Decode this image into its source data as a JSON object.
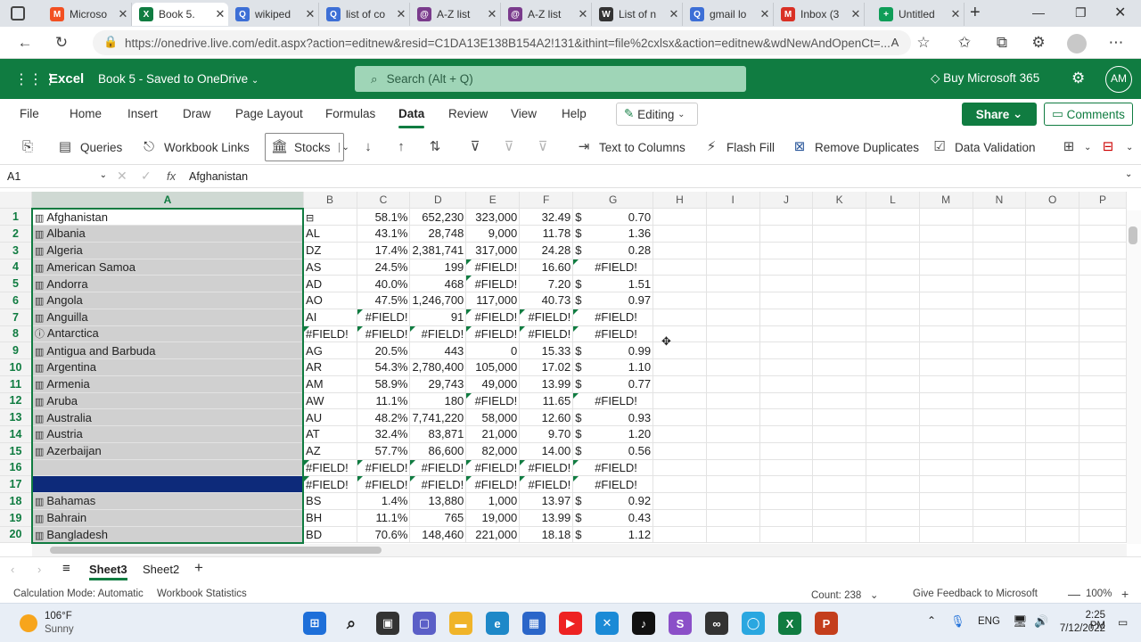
{
  "browser": {
    "tabs": [
      {
        "title": "Microso",
        "fav": "M",
        "color": "#f25022"
      },
      {
        "title": "Book 5.",
        "fav": "X",
        "color": "#107c41",
        "active": true
      },
      {
        "title": "wikiped",
        "fav": "Q",
        "color": "#3d6fd6"
      },
      {
        "title": "list of co",
        "fav": "Q",
        "color": "#3d6fd6"
      },
      {
        "title": "A-Z list",
        "fav": "@",
        "color": "#7a3b8c"
      },
      {
        "title": "A-Z list",
        "fav": "@",
        "color": "#7a3b8c"
      },
      {
        "title": "List of n",
        "fav": "W",
        "color": "#333333"
      },
      {
        "title": "gmail lo",
        "fav": "Q",
        "color": "#3d6fd6"
      },
      {
        "title": "Inbox (3",
        "fav": "M",
        "color": "#d93025"
      },
      {
        "title": "Untitled",
        "fav": "+",
        "color": "#0f9d58"
      }
    ],
    "url": "https://onedrive.live.com/edit.aspx?action=editnew&resid=C1DA13E138B154A2!131&ithint=file%2cxlsx&action=editnew&wdNewAndOpenCt=..."
  },
  "excel": {
    "app": "Excel",
    "doc_title": "Book 5 - Saved to OneDrive",
    "search_placeholder": "Search (Alt + Q)",
    "buy": "Buy Microsoft 365",
    "avatar": "AM",
    "ribbon_tabs": [
      "File",
      "Home",
      "Insert",
      "Draw",
      "Page Layout",
      "Formulas",
      "Data",
      "Review",
      "View",
      "Help"
    ],
    "editing": "Editing",
    "share": "Share",
    "comments": "Comments",
    "ribbon": {
      "queries": "Queries",
      "workbook_links": "Workbook Links",
      "stocks": "Stocks",
      "text_to_columns": "Text to Columns",
      "flash_fill": "Flash Fill",
      "remove_duplicates": "Remove Duplicates",
      "data_validation": "Data Validation"
    },
    "name_box": "A1",
    "formula": "Afghanistan",
    "columns": [
      "A",
      "B",
      "C",
      "D",
      "E",
      "F",
      "G",
      "H",
      "I",
      "J",
      "K",
      "L",
      "M",
      "N",
      "O",
      "P"
    ],
    "rows": [
      {
        "n": "1",
        "a": "Afghanistan",
        "b": "",
        "c": "58.1%",
        "d": "652,230",
        "e": "323,000",
        "f": "32.49",
        "g": "0.70"
      },
      {
        "n": "2",
        "a": "Albania",
        "b": "AL",
        "c": "43.1%",
        "d": "28,748",
        "e": "9,000",
        "f": "11.78",
        "g": "1.36"
      },
      {
        "n": "3",
        "a": "Algeria",
        "b": "DZ",
        "c": "17.4%",
        "d": "2,381,741",
        "e": "317,000",
        "f": "24.28",
        "g": "0.28"
      },
      {
        "n": "4",
        "a": "American Samoa",
        "b": "AS",
        "c": "24.5%",
        "d": "199",
        "e": "#FIELD!",
        "f": "16.60",
        "g": "#FIELD!"
      },
      {
        "n": "5",
        "a": "Andorra",
        "b": "AD",
        "c": "40.0%",
        "d": "468",
        "e": "#FIELD!",
        "f": "7.20",
        "g": "1.51"
      },
      {
        "n": "6",
        "a": "Angola",
        "b": "AO",
        "c": "47.5%",
        "d": "1,246,700",
        "e": "117,000",
        "f": "40.73",
        "g": "0.97"
      },
      {
        "n": "7",
        "a": "Anguilla",
        "b": "AI",
        "c": "#FIELD!",
        "d": "91",
        "e": "#FIELD!",
        "f": "#FIELD!",
        "g": "#FIELD!"
      },
      {
        "n": "8",
        "a": "Antarctica",
        "b": "#FIELD!",
        "c": "#FIELD!",
        "d": "#FIELD!",
        "e": "#FIELD!",
        "f": "#FIELD!",
        "g": "#FIELD!"
      },
      {
        "n": "9",
        "a": "Antigua and Barbuda",
        "b": "AG",
        "c": "20.5%",
        "d": "443",
        "e": "0",
        "f": "15.33",
        "g": "0.99"
      },
      {
        "n": "10",
        "a": "Argentina",
        "b": "AR",
        "c": "54.3%",
        "d": "2,780,400",
        "e": "105,000",
        "f": "17.02",
        "g": "1.10"
      },
      {
        "n": "11",
        "a": "Armenia",
        "b": "AM",
        "c": "58.9%",
        "d": "29,743",
        "e": "49,000",
        "f": "13.99",
        "g": "0.77"
      },
      {
        "n": "12",
        "a": "Aruba",
        "b": "AW",
        "c": "11.1%",
        "d": "180",
        "e": "#FIELD!",
        "f": "11.65",
        "g": "#FIELD!"
      },
      {
        "n": "13",
        "a": "Australia",
        "b": "AU",
        "c": "48.2%",
        "d": "7,741,220",
        "e": "58,000",
        "f": "12.60",
        "g": "0.93"
      },
      {
        "n": "14",
        "a": "Austria",
        "b": "AT",
        "c": "32.4%",
        "d": "83,871",
        "e": "21,000",
        "f": "9.70",
        "g": "1.20"
      },
      {
        "n": "15",
        "a": "Azerbaijan",
        "b": "AZ",
        "c": "57.7%",
        "d": "86,600",
        "e": "82,000",
        "f": "14.00",
        "g": "0.56"
      },
      {
        "n": "16",
        "a": "",
        "b": "#FIELD!",
        "c": "#FIELD!",
        "d": "#FIELD!",
        "e": "#FIELD!",
        "f": "#FIELD!",
        "g": "#FIELD!"
      },
      {
        "n": "17",
        "a": "",
        "b": "#FIELD!",
        "c": "#FIELD!",
        "d": "#FIELD!",
        "e": "#FIELD!",
        "f": "#FIELD!",
        "g": "#FIELD!"
      },
      {
        "n": "18",
        "a": "Bahamas",
        "b": "BS",
        "c": "1.4%",
        "d": "13,880",
        "e": "1,000",
        "f": "13.97",
        "g": "0.92"
      },
      {
        "n": "19",
        "a": "Bahrain",
        "b": "BH",
        "c": "11.1%",
        "d": "765",
        "e": "19,000",
        "f": "13.99",
        "g": "0.43"
      },
      {
        "n": "20",
        "a": "Bangladesh",
        "b": "BD",
        "c": "70.6%",
        "d": "148,460",
        "e": "221,000",
        "f": "18.18",
        "g": "1.12"
      }
    ],
    "sheets": [
      "Sheet3",
      "Sheet2"
    ],
    "active_sheet": "Sheet3",
    "status": {
      "calc": "Calculation Mode: Automatic",
      "stats": "Workbook Statistics",
      "count": "Count: 238",
      "feedback": "Give Feedback to Microsoft",
      "zoom": "100%"
    }
  },
  "taskbar": {
    "temp": "106°F",
    "weather": "Sunny",
    "lang": "ENG",
    "time": "2:25 PM",
    "date": "7/12/2022"
  }
}
